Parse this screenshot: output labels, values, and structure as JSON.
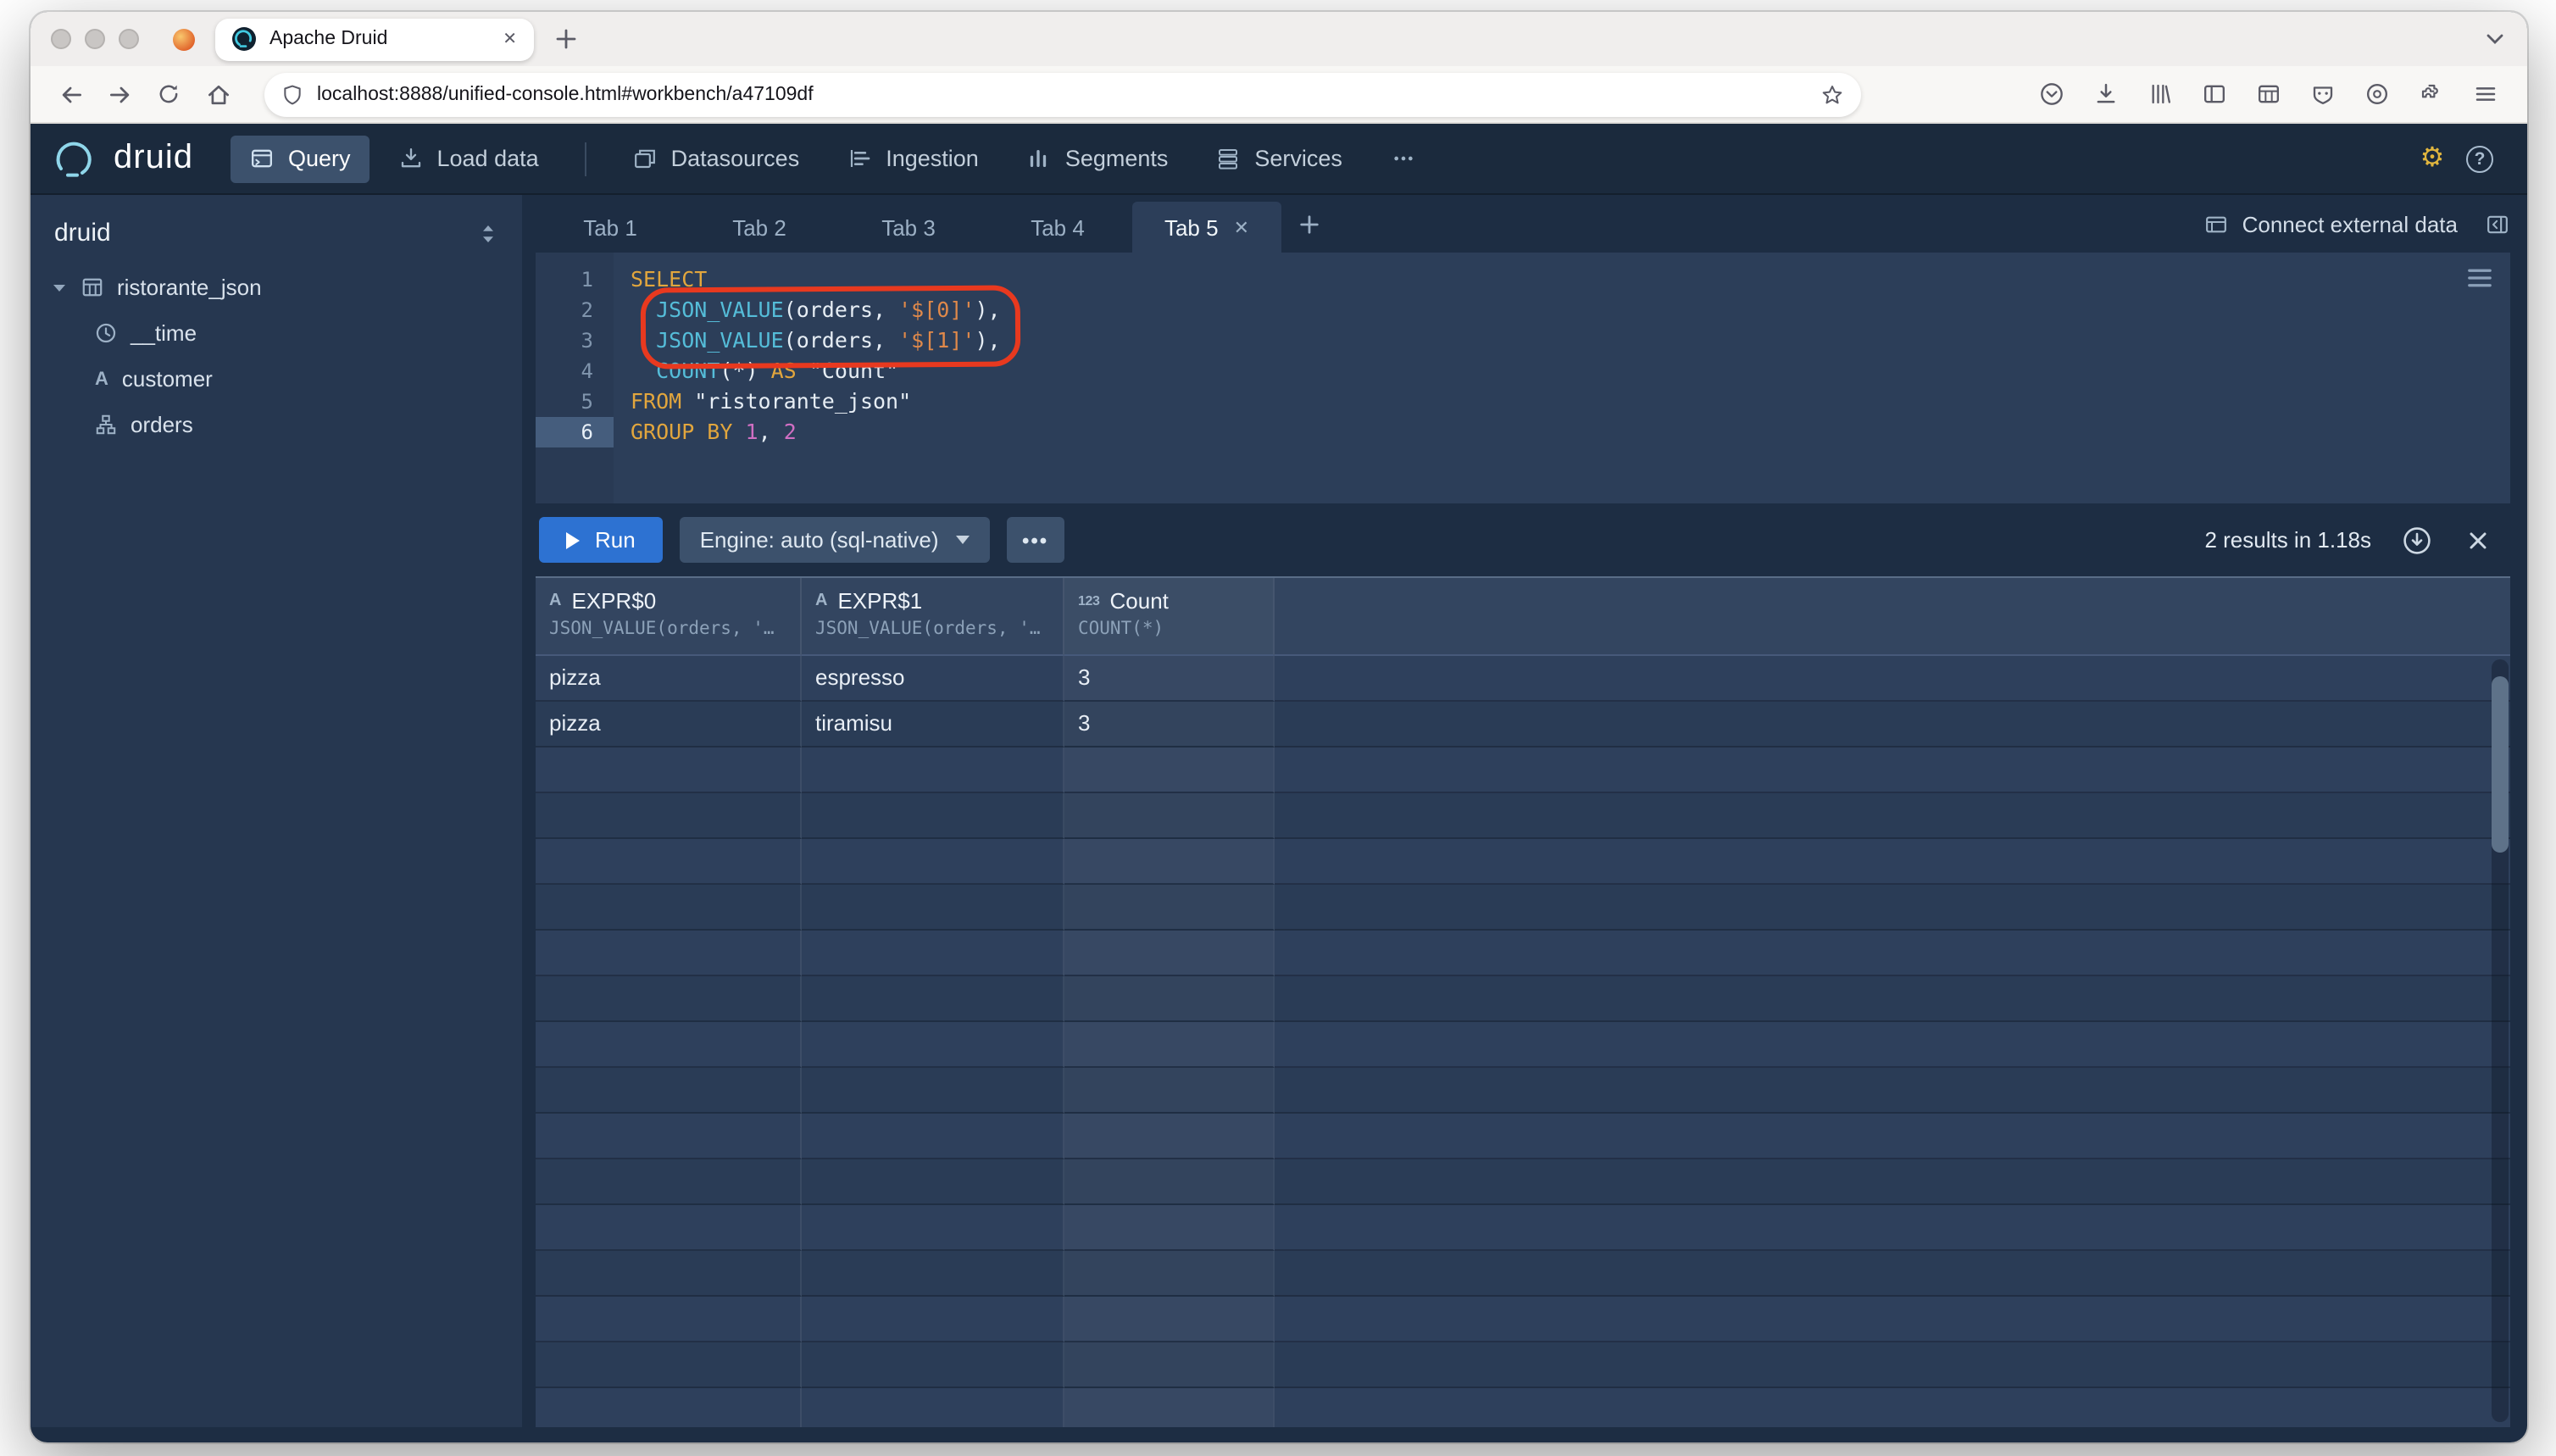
{
  "browser": {
    "tab_title": "Apache Druid",
    "url": "localhost:8888/unified-console.html#workbench/a47109df"
  },
  "app_header": {
    "brand": "druid",
    "nav": [
      {
        "label": "Query",
        "active": true
      },
      {
        "label": "Load data",
        "active": false
      },
      {
        "label": "Datasources",
        "active": false
      },
      {
        "label": "Ingestion",
        "active": false
      },
      {
        "label": "Segments",
        "active": false
      },
      {
        "label": "Services",
        "active": false
      }
    ]
  },
  "sidebar": {
    "schema": "druid",
    "datasource": "ristorante_json",
    "columns": [
      {
        "name": "__time",
        "type": "time"
      },
      {
        "name": "customer",
        "type": "string"
      },
      {
        "name": "orders",
        "type": "nested"
      }
    ]
  },
  "workbench": {
    "tabs": [
      {
        "label": "Tab 1",
        "active": false
      },
      {
        "label": "Tab 2",
        "active": false
      },
      {
        "label": "Tab 3",
        "active": false
      },
      {
        "label": "Tab 4",
        "active": false
      },
      {
        "label": "Tab 5",
        "active": true
      }
    ],
    "connect_label": "Connect external data"
  },
  "editor": {
    "lines": [
      {
        "n": 1,
        "active": false,
        "tokens": [
          {
            "c": "kw",
            "t": "SELECT"
          }
        ]
      },
      {
        "n": 2,
        "active": false,
        "tokens": [
          {
            "c": "pl",
            "t": "  "
          },
          {
            "c": "fn",
            "t": "JSON_VALUE"
          },
          {
            "c": "df",
            "t": "(orders, "
          },
          {
            "c": "str",
            "t": "'$[0]'"
          },
          {
            "c": "df",
            "t": "),"
          }
        ]
      },
      {
        "n": 3,
        "active": false,
        "tokens": [
          {
            "c": "pl",
            "t": "  "
          },
          {
            "c": "fn",
            "t": "JSON_VALUE"
          },
          {
            "c": "df",
            "t": "(orders, "
          },
          {
            "c": "str",
            "t": "'$[1]'"
          },
          {
            "c": "df",
            "t": "),"
          }
        ]
      },
      {
        "n": 4,
        "active": false,
        "tokens": [
          {
            "c": "pl",
            "t": "  "
          },
          {
            "c": "fn",
            "t": "COUNT"
          },
          {
            "c": "df",
            "t": "(*) "
          },
          {
            "c": "kw",
            "t": "AS"
          },
          {
            "c": "df",
            "t": " "
          },
          {
            "c": "qid",
            "t": "\"Count\""
          }
        ]
      },
      {
        "n": 5,
        "active": false,
        "tokens": [
          {
            "c": "kw",
            "t": "FROM"
          },
          {
            "c": "df",
            "t": " "
          },
          {
            "c": "qid",
            "t": "\"ristorante_json\""
          }
        ]
      },
      {
        "n": 6,
        "active": true,
        "tokens": [
          {
            "c": "kw",
            "t": "GROUP BY"
          },
          {
            "c": "df",
            "t": " "
          },
          {
            "c": "num",
            "t": "1"
          },
          {
            "c": "df",
            "t": ", "
          },
          {
            "c": "num",
            "t": "2"
          }
        ]
      }
    ]
  },
  "run_bar": {
    "run_label": "Run",
    "engine_label": "Engine: auto (sql-native)",
    "result_summary": "2 results in 1.18s"
  },
  "results": {
    "columns": [
      {
        "name": "EXPR$0",
        "type_icon": "A",
        "expression": "JSON_VALUE(orders, '…"
      },
      {
        "name": "EXPR$1",
        "type_icon": "A",
        "expression": "JSON_VALUE(orders, '…"
      },
      {
        "name": "Count",
        "type_icon": "123",
        "expression": "COUNT(*)"
      }
    ],
    "rows": [
      [
        "pizza",
        "espresso",
        "3"
      ],
      [
        "pizza",
        "tiramisu",
        "3"
      ]
    ],
    "empty_rows": 15
  },
  "colors": {
    "accent_blue": "#2d72d2",
    "annotation_red": "#e8391f",
    "keyword": "#e2a63d",
    "function": "#55bdd9",
    "string": "#e0894a",
    "number": "#d06fc3",
    "header_navy": "#1b2a3d",
    "panel": "#2c3e59"
  }
}
